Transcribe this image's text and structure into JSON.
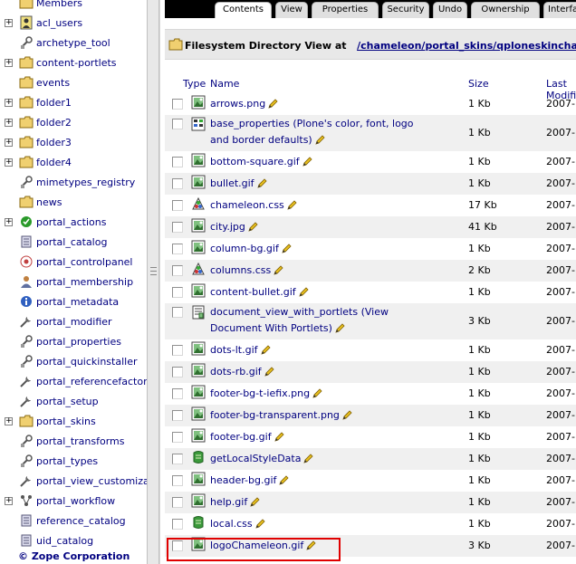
{
  "tree": {
    "items": [
      {
        "label": "Members",
        "icon": "folder-icon",
        "expander": ""
      },
      {
        "label": "acl_users",
        "icon": "acl-users-icon",
        "expander": "+"
      },
      {
        "label": "archetype_tool",
        "icon": "tool-icon",
        "expander": ""
      },
      {
        "label": "content-portlets",
        "icon": "folder-icon",
        "expander": "+"
      },
      {
        "label": "events",
        "icon": "folder-icon",
        "expander": ""
      },
      {
        "label": "folder1",
        "icon": "folder-icon",
        "expander": "+"
      },
      {
        "label": "folder2",
        "icon": "folder-icon",
        "expander": "+"
      },
      {
        "label": "folder3",
        "icon": "folder-icon",
        "expander": "+"
      },
      {
        "label": "folder4",
        "icon": "folder-icon",
        "expander": "+"
      },
      {
        "label": "mimetypes_registry",
        "icon": "tool-icon",
        "expander": ""
      },
      {
        "label": "news",
        "icon": "folder-icon",
        "expander": ""
      },
      {
        "label": "portal_actions",
        "icon": "check-circle-icon",
        "expander": "+"
      },
      {
        "label": "portal_catalog",
        "icon": "catalog-icon",
        "expander": ""
      },
      {
        "label": "portal_controlpanel",
        "icon": "controlpanel-icon",
        "expander": ""
      },
      {
        "label": "portal_membership",
        "icon": "user-icon",
        "expander": ""
      },
      {
        "label": "portal_metadata",
        "icon": "info-icon",
        "expander": ""
      },
      {
        "label": "portal_modifier",
        "icon": "wrench-icon",
        "expander": ""
      },
      {
        "label": "portal_properties",
        "icon": "tool-icon",
        "expander": ""
      },
      {
        "label": "portal_quickinstaller",
        "icon": "tool-icon",
        "expander": ""
      },
      {
        "label": "portal_referencefactor",
        "icon": "wrench-icon",
        "expander": ""
      },
      {
        "label": "portal_setup",
        "icon": "wrench-icon",
        "expander": ""
      },
      {
        "label": "portal_skins",
        "icon": "folder-icon",
        "expander": "+"
      },
      {
        "label": "portal_transforms",
        "icon": "tool-icon",
        "expander": ""
      },
      {
        "label": "portal_types",
        "icon": "tool-icon",
        "expander": ""
      },
      {
        "label": "portal_view_customiza",
        "icon": "wrench-icon",
        "expander": ""
      },
      {
        "label": "portal_workflow",
        "icon": "workflow-icon",
        "expander": "+"
      },
      {
        "label": "reference_catalog",
        "icon": "catalog-icon",
        "expander": ""
      },
      {
        "label": "uid_catalog",
        "icon": "catalog-icon",
        "expander": ""
      }
    ],
    "footer": "© Zope Corporation"
  },
  "tabs": [
    {
      "label": "Contents",
      "active": true
    },
    {
      "label": "View",
      "active": false
    },
    {
      "label": "Properties",
      "active": false
    },
    {
      "label": "Security",
      "active": false
    },
    {
      "label": "Undo",
      "active": false
    },
    {
      "label": "Ownership",
      "active": false
    },
    {
      "label": "Interfaces",
      "active": false
    }
  ],
  "header": {
    "prefix": "Filesystem Directory View at",
    "path": "/chameleon/portal_skins/qploneskinchameleon"
  },
  "columns": {
    "type": "Type",
    "name": "Name",
    "size": "Size",
    "modified": "Last Modified"
  },
  "files": [
    {
      "name": "arrows.png",
      "size": "1 Kb",
      "modified": "2007-",
      "icon": "image-icon"
    },
    {
      "name": "base_properties (Plone's color, font, logo and border defaults)",
      "size": "1 Kb",
      "modified": "2007-",
      "icon": "properties-icon"
    },
    {
      "name": "bottom-square.gif",
      "size": "1 Kb",
      "modified": "2007-",
      "icon": "image-icon"
    },
    {
      "name": "bullet.gif",
      "size": "1 Kb",
      "modified": "2007-",
      "icon": "image-icon"
    },
    {
      "name": "chameleon.css",
      "size": "17 Kb",
      "modified": "2007-",
      "icon": "css-icon"
    },
    {
      "name": "city.jpg",
      "size": "41 Kb",
      "modified": "2007-",
      "icon": "image-icon"
    },
    {
      "name": "column-bg.gif",
      "size": "1 Kb",
      "modified": "2007-",
      "icon": "image-icon"
    },
    {
      "name": "columns.css",
      "size": "2 Kb",
      "modified": "2007-",
      "icon": "css-icon"
    },
    {
      "name": "content-bullet.gif",
      "size": "1 Kb",
      "modified": "2007-",
      "icon": "image-icon"
    },
    {
      "name": "document_view_with_portlets (View Document With Portlets)",
      "size": "3 Kb",
      "modified": "2007-",
      "icon": "template-icon"
    },
    {
      "name": "dots-lt.gif",
      "size": "1 Kb",
      "modified": "2007-",
      "icon": "image-icon"
    },
    {
      "name": "dots-rb.gif",
      "size": "1 Kb",
      "modified": "2007-",
      "icon": "image-icon"
    },
    {
      "name": "footer-bg-t-iefix.png",
      "size": "1 Kb",
      "modified": "2007-",
      "icon": "image-icon"
    },
    {
      "name": "footer-bg-transparent.png",
      "size": "1 Kb",
      "modified": "2007-",
      "icon": "image-icon"
    },
    {
      "name": "footer-bg.gif",
      "size": "1 Kb",
      "modified": "2007-",
      "icon": "image-icon"
    },
    {
      "name": "getLocalStyleData",
      "size": "1 Kb",
      "modified": "2007-",
      "icon": "script-icon"
    },
    {
      "name": "header-bg.gif",
      "size": "1 Kb",
      "modified": "2007-",
      "icon": "image-icon"
    },
    {
      "name": "help.gif",
      "size": "1 Kb",
      "modified": "2007-",
      "icon": "image-icon"
    },
    {
      "name": "local.css",
      "size": "1 Kb",
      "modified": "2007-",
      "icon": "script-icon"
    },
    {
      "name": "logoChameleon.gif",
      "size": "3 Kb",
      "modified": "2007-",
      "icon": "image-icon"
    }
  ],
  "colors": {
    "link": "#000080",
    "tabbar": "#000000",
    "header_bg": "#e8e8e8",
    "row_alt": "#f0f0f0",
    "highlight": "#e00000"
  }
}
